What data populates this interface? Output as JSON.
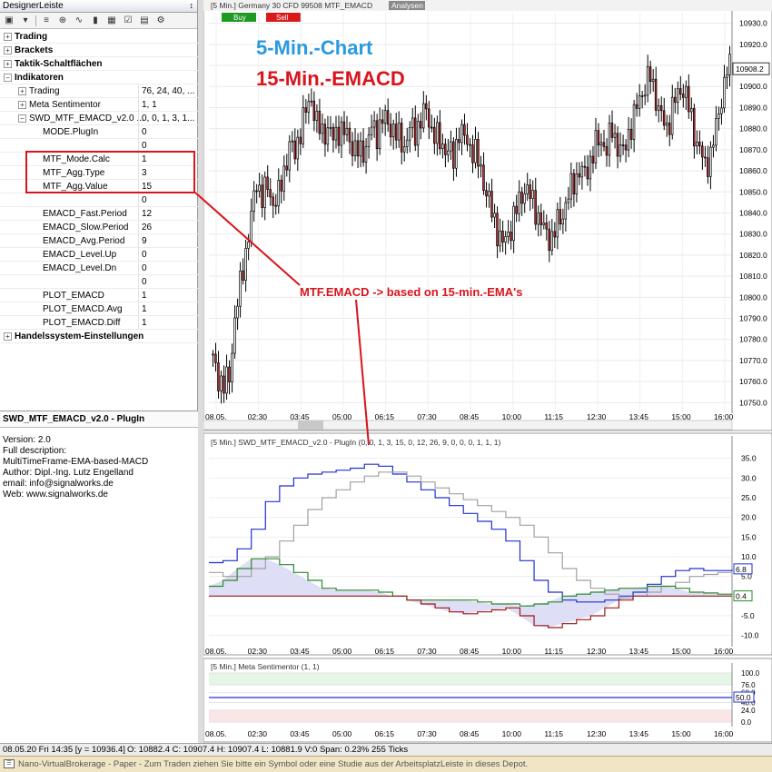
{
  "designer": {
    "title": "DesignerLeiste",
    "pin": "↕",
    "rows": [
      {
        "level": 0,
        "exp": "+",
        "label": "Trading",
        "value": "",
        "bold": true
      },
      {
        "level": 0,
        "exp": "+",
        "label": "Brackets",
        "value": "",
        "bold": true
      },
      {
        "level": 0,
        "exp": "+",
        "label": "Taktik-Schaltflächen",
        "value": "",
        "bold": true
      },
      {
        "level": 0,
        "exp": "−",
        "label": "Indikatoren",
        "value": "",
        "bold": true
      },
      {
        "level": 1,
        "exp": "+",
        "label": "Trading",
        "value": "76, 24, 40, ..."
      },
      {
        "level": 1,
        "exp": "+",
        "label": "Meta Sentimentor",
        "value": "1, 1"
      },
      {
        "level": 1,
        "exp": "−",
        "label": "SWD_MTF_EMACD_v2.0 ...",
        "value": "0, 0, 1, 3, 1..."
      },
      {
        "level": 2,
        "label": "MODE.PlugIn",
        "value": "0"
      },
      {
        "level": 2,
        "label": "",
        "value": "0"
      },
      {
        "level": 2,
        "label": "MTF_Mode.Calc",
        "value": "1"
      },
      {
        "level": 2,
        "label": "MTF_Agg.Type",
        "value": "3"
      },
      {
        "level": 2,
        "label": "MTF_Agg.Value",
        "value": "15"
      },
      {
        "level": 2,
        "label": "",
        "value": "0"
      },
      {
        "level": 2,
        "label": "EMACD_Fast.Period",
        "value": "12"
      },
      {
        "level": 2,
        "label": "EMACD_Slow.Period",
        "value": "26"
      },
      {
        "level": 2,
        "label": "EMACD_Avg.Period",
        "value": "9"
      },
      {
        "level": 2,
        "label": "EMACD_Level.Up",
        "value": "0"
      },
      {
        "level": 2,
        "label": "EMACD_Level.Dn",
        "value": "0"
      },
      {
        "level": 2,
        "label": "",
        "value": "0"
      },
      {
        "level": 2,
        "label": "PLOT_EMACD",
        "value": "1"
      },
      {
        "level": 2,
        "label": "PLOT_EMACD.Avg",
        "value": "1"
      },
      {
        "level": 2,
        "label": "PLOT_EMACD.Diff",
        "value": "1"
      },
      {
        "level": 0,
        "exp": "+",
        "label": "Handelssystem-Einstellungen",
        "value": "",
        "bold": true
      }
    ],
    "desc_title": "SWD_MTF_EMACD_v2.0 - PlugIn",
    "desc_lines": [
      "Version: 2.0",
      "Full description:",
      "MultiTimeFrame-EMA-based-MACD",
      "Author: Dipl.-Ing. Lutz Engelland",
      "email: info@signalworks.de",
      "Web: www.signalworks.de"
    ]
  },
  "chart": {
    "header": "[5 Min.] Germany 30 CFD   99508 MTF_EMACD",
    "analysen_label": "Analysen",
    "buy_label": "Buy",
    "sell_label": "Sell",
    "title_line1": "5-Min.-Chart",
    "title_line2": "15-Min.-EMACD",
    "annotation": "MTF.EMACD -> based on 15-min.-EMA's",
    "title_color_1": "#2a9ae0",
    "title_color_2": "#d8141c",
    "price_label": "10908.2",
    "macd_header": "[5 Min.] SWD_MTF_EMACD_v2.0 - PlugIn  (0, 0, 1, 3, 15, 0, 12, 26, 9, 0, 0, 0, 1, 1, 1)",
    "macd_label_a": "6.8",
    "macd_label_b": "0.4",
    "meta_header": "[5 Min.] Meta Sentimentor  (1, 1)",
    "meta_label": "50.0"
  },
  "chart_data": [
    {
      "type": "candlestick",
      "title": "5-Min.-Chart",
      "x_ticks": [
        "08.05.",
        "02:30",
        "03:45",
        "05:00",
        "06:15",
        "07:30",
        "08:45",
        "10:00",
        "11:15",
        "12:30",
        "13:45",
        "15:00",
        "16:00"
      ],
      "y_ticks": [
        10750,
        10760,
        10770,
        10780,
        10790,
        10800,
        10810,
        10820,
        10830,
        10840,
        10850,
        10860,
        10870,
        10880,
        10890,
        10900,
        10910,
        10920,
        10930
      ],
      "ylim": [
        10748,
        10935
      ],
      "close_path": [
        10770,
        10762,
        10758,
        10762,
        10790,
        10805,
        10822,
        10838,
        10855,
        10848,
        10852,
        10845,
        10848,
        10860,
        10872,
        10868,
        10880,
        10888,
        10895,
        10882,
        10878,
        10880,
        10875,
        10880,
        10878,
        10875,
        10870,
        10868,
        10872,
        10880,
        10878,
        10885,
        10882,
        10880,
        10875,
        10872,
        10880,
        10878,
        10885,
        10888,
        10880,
        10875,
        10872,
        10870,
        10865,
        10880,
        10875,
        10872,
        10868,
        10860,
        10850,
        10840,
        10832,
        10825,
        10830,
        10838,
        10845,
        10852,
        10848,
        10842,
        10835,
        10830,
        10828,
        10835,
        10840,
        10848,
        10855,
        10860,
        10858,
        10865,
        10872,
        10875,
        10870,
        10880,
        10872,
        10868,
        10878,
        10885,
        10895,
        10900,
        10905,
        10895,
        10885,
        10880,
        10890,
        10896,
        10900,
        10890,
        10878,
        10870,
        10862,
        10868,
        10880,
        10895,
        10908
      ]
    },
    {
      "type": "line",
      "title": "[5 Min.] SWD_MTF_EMACD_v2.0 - PlugIn  (0, 0, 1, 3, 15, 0, 12, 26, 9, 0, 0, 0, 1, 1, 1)",
      "y_ticks": [
        -10,
        -5,
        0,
        5,
        10,
        15,
        20,
        25,
        30,
        35
      ],
      "ylim": [
        -11,
        37
      ],
      "series": [
        {
          "color": "#2030d0",
          "values": [
            8.5,
            9,
            12,
            17,
            24,
            28,
            30,
            31,
            31.5,
            32,
            32.5,
            33.5,
            33,
            31,
            29,
            27,
            25,
            23,
            21,
            19,
            17,
            14,
            9,
            4,
            1,
            -1,
            -1.5,
            -1.5,
            -1,
            0,
            1,
            3,
            5,
            6.5,
            7,
            6.5,
            6.5,
            6.8
          ]
        },
        {
          "color": "#a0a0a0",
          "values": [
            6,
            5,
            5,
            7,
            10,
            14,
            18,
            22,
            25,
            27,
            29,
            30.5,
            31.5,
            31.5,
            30.5,
            29,
            27.5,
            26,
            24.5,
            23,
            21.5,
            20,
            18,
            15,
            11,
            7,
            4,
            2,
            0.5,
            -0.5,
            0,
            1,
            2.5,
            3.5,
            5,
            5.5,
            6,
            6.3
          ]
        },
        {
          "color": "#2a8a2a",
          "values": [
            2.5,
            4,
            7,
            9.5,
            9.5,
            8,
            6,
            4,
            2,
            1.5,
            1.5,
            1.5,
            1,
            0,
            -1,
            -1,
            -1,
            -1,
            -1,
            -1.5,
            -2,
            -2,
            -2.5,
            -2,
            -1.5,
            0,
            0.5,
            1,
            1.5,
            2,
            2,
            2.5,
            2.5,
            2,
            1,
            0.8,
            0.5,
            0.4
          ]
        },
        {
          "color": "#a01818",
          "values": [
            0,
            0,
            0,
            0,
            0,
            0,
            0,
            0,
            0,
            0,
            0,
            0,
            0,
            0,
            -1,
            -2,
            -3,
            -4,
            -4.5,
            -4,
            -3.5,
            -3,
            -5,
            -7.5,
            -8,
            -7,
            -6,
            -5,
            -3,
            -1,
            0,
            0,
            0,
            0,
            0,
            0,
            0,
            0
          ]
        }
      ]
    },
    {
      "type": "line",
      "title": "[5 Min.] Meta Sentimentor  (1, 1)",
      "y_ticks": [
        0,
        24,
        40,
        60,
        76,
        100
      ],
      "ylim": [
        0,
        100
      ],
      "series": [
        {
          "color": "#2030d0",
          "values": [
            50,
            50
          ]
        }
      ]
    }
  ],
  "status": {
    "left": "08.05.20 Fri  14:35 [y = 10936.4]",
    "ohlc": "O: 10882.4 C: 10907.4 H: 10907.4 L: 10881.9 V:0 Span: 0.23% 255 Ticks",
    "message": "Nano-VirtualBrokerage - Paper - Zum Traden ziehen Sie bitte ein Symbol oder eine Studie aus der ArbeitsplatzLeiste in dieses Depot."
  }
}
